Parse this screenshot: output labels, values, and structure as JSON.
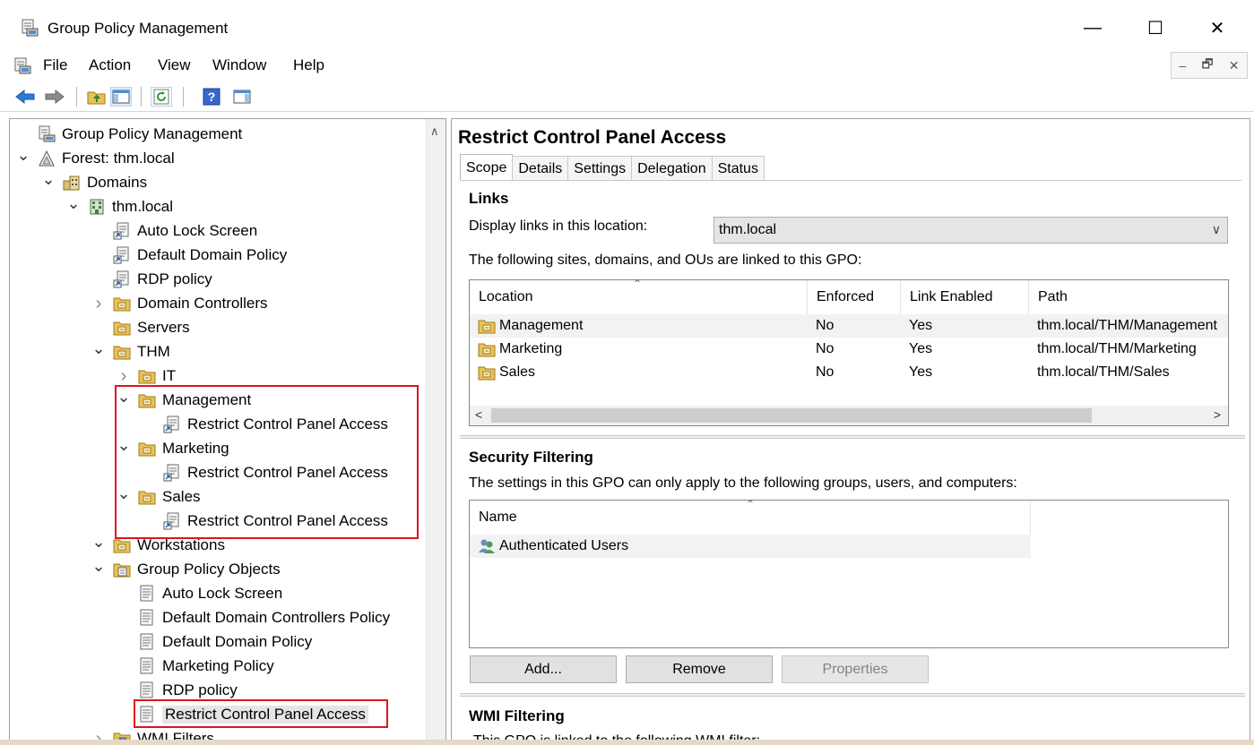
{
  "window": {
    "title": "Group Policy Management",
    "controls": {
      "minimize": "—",
      "maximize": "☐",
      "close": "✕"
    }
  },
  "menu": {
    "items": [
      "File",
      "Action",
      "View",
      "Window",
      "Help"
    ],
    "mdi": {
      "minimize": "–",
      "restore": "🗗",
      "close": "✕"
    }
  },
  "toolbar": {
    "icons": [
      "back-arrow-icon",
      "forward-arrow-icon",
      "up-folder-icon",
      "show-hide-tree-icon",
      "refresh-icon",
      "help-icon",
      "action-pane-icon"
    ]
  },
  "tree": {
    "nodes": [
      {
        "label": "Group Policy Management",
        "icon": "gpm-console-icon",
        "expander": ""
      },
      {
        "label": "Forest: thm.local",
        "icon": "forest-icon",
        "expander": "expanded"
      },
      {
        "label": "Domains",
        "icon": "domains-icon",
        "expander": "expanded"
      },
      {
        "label": "thm.local",
        "icon": "domain-icon",
        "expander": "expanded"
      },
      {
        "label": "Auto Lock Screen",
        "icon": "gpo-link-icon",
        "expander": ""
      },
      {
        "label": "Default Domain Policy",
        "icon": "gpo-link-icon",
        "expander": ""
      },
      {
        "label": "RDP policy",
        "icon": "gpo-link-icon",
        "expander": ""
      },
      {
        "label": "Domain Controllers",
        "icon": "ou-folder-icon",
        "expander": "collapsed"
      },
      {
        "label": "Servers",
        "icon": "ou-folder-icon",
        "expander": ""
      },
      {
        "label": "THM",
        "icon": "ou-folder-icon",
        "expander": "expanded"
      },
      {
        "label": "IT",
        "icon": "ou-folder-icon",
        "expander": "collapsed"
      },
      {
        "label": "Management",
        "icon": "ou-folder-icon",
        "expander": "expanded"
      },
      {
        "label": "Restrict Control Panel Access",
        "icon": "gpo-link-icon",
        "expander": ""
      },
      {
        "label": "Marketing",
        "icon": "ou-folder-icon",
        "expander": "expanded"
      },
      {
        "label": "Restrict Control Panel Access",
        "icon": "gpo-link-icon",
        "expander": ""
      },
      {
        "label": "Sales",
        "icon": "ou-folder-icon",
        "expander": "expanded"
      },
      {
        "label": "Restrict Control Panel Access",
        "icon": "gpo-link-icon",
        "expander": ""
      },
      {
        "label": "Workstations",
        "icon": "ou-folder-icon",
        "expander": "expanded"
      },
      {
        "label": "Group Policy Objects",
        "icon": "gpo-container-icon",
        "expander": "expanded"
      },
      {
        "label": "Auto Lock Screen",
        "icon": "gpo-icon",
        "expander": ""
      },
      {
        "label": "Default Domain Controllers Policy",
        "icon": "gpo-icon",
        "expander": ""
      },
      {
        "label": "Default Domain Policy",
        "icon": "gpo-icon",
        "expander": ""
      },
      {
        "label": "Marketing Policy",
        "icon": "gpo-icon",
        "expander": ""
      },
      {
        "label": "RDP policy",
        "icon": "gpo-icon",
        "expander": ""
      },
      {
        "label": "Restrict Control Panel Access",
        "icon": "gpo-icon",
        "expander": "",
        "selected": true
      },
      {
        "label": "WMI Filters",
        "icon": "wmi-filter-icon",
        "expander": "collapsed"
      }
    ]
  },
  "details": {
    "title": "Restrict Control Panel Access",
    "tabs": [
      "Scope",
      "Details",
      "Settings",
      "Delegation",
      "Status"
    ],
    "active_tab": "Scope",
    "links": {
      "heading": "Links",
      "display_label": "Display links in this location:",
      "display_value": "thm.local",
      "description": "The following sites, domains, and OUs are linked to this GPO:",
      "columns": [
        "Location",
        "Enforced",
        "Link Enabled",
        "Path"
      ],
      "rows": [
        {
          "location": "Management",
          "enforced": "No",
          "link_enabled": "Yes",
          "path": "thm.local/THM/Management"
        },
        {
          "location": "Marketing",
          "enforced": "No",
          "link_enabled": "Yes",
          "path": "thm.local/THM/Marketing"
        },
        {
          "location": "Sales",
          "enforced": "No",
          "link_enabled": "Yes",
          "path": "thm.local/THM/Sales"
        }
      ]
    },
    "security": {
      "heading": "Security Filtering",
      "description": "The settings in this GPO can only apply to the following groups, users, and computers:",
      "column": "Name",
      "rows": [
        "Authenticated Users"
      ],
      "buttons": {
        "add": "Add...",
        "remove": "Remove",
        "properties": "Properties"
      }
    },
    "wmi": {
      "heading": "WMI Filtering",
      "description": "This GPO is linked to the following WMI filter:"
    }
  },
  "colors": {
    "highlight_box": "#e0141e",
    "selection": "#e5e5e5"
  }
}
